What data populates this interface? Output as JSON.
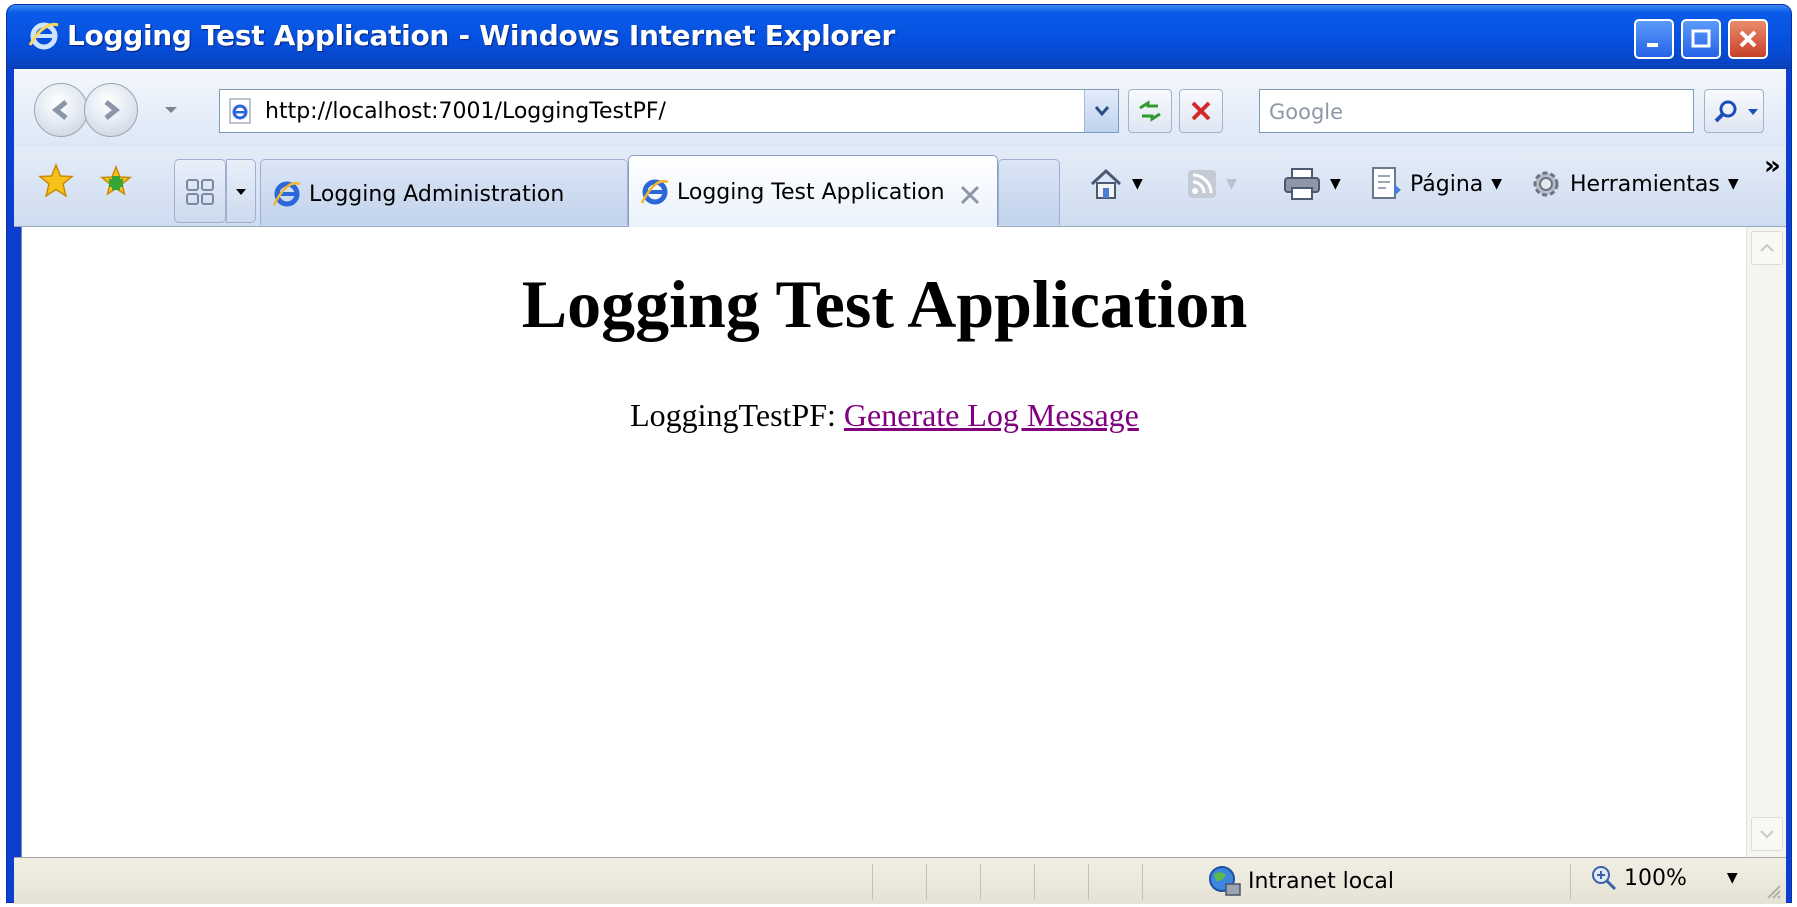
{
  "window": {
    "title": "Logging Test Application - Windows Internet Explorer"
  },
  "navbar": {
    "back_icon": "back-arrow-icon",
    "forward_icon": "forward-arrow-icon",
    "address_url": "http://localhost:7001/LoggingTestPF/",
    "search_placeholder": "Google"
  },
  "tabs": [
    {
      "label": "Logging Administration",
      "active": false
    },
    {
      "label": "Logging Test Application",
      "active": true
    }
  ],
  "toolbar": {
    "page_label": "Página",
    "tools_label": "Herramientas",
    "more": "»"
  },
  "page": {
    "heading": "Logging Test Application",
    "line_prefix": "LoggingTestPF: ",
    "link_text": "Generate Log Message"
  },
  "status": {
    "zone": "Intranet local",
    "zoom": "100%"
  },
  "colors": {
    "title_bar": "#0650e0",
    "visited_link": "#800080"
  }
}
